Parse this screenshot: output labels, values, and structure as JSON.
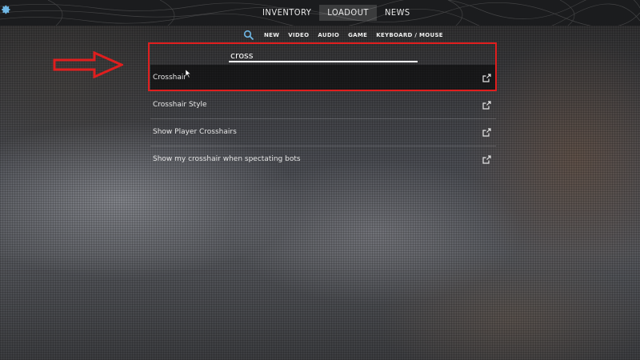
{
  "top_nav": {
    "tabs": [
      {
        "label": "INVENTORY",
        "active": false
      },
      {
        "label": "LOADOUT",
        "active": true
      },
      {
        "label": "NEWS",
        "active": false
      }
    ]
  },
  "settings_icon": "gear-icon",
  "sub_nav": {
    "search_icon": "search-icon",
    "items": [
      "NEW",
      "VIDEO",
      "AUDIO",
      "GAME",
      "KEYBOARD / MOUSE"
    ]
  },
  "search": {
    "value": "cross",
    "placeholder": ""
  },
  "results": [
    {
      "label": "Crosshair",
      "icon": "external-link-icon"
    },
    {
      "label": "Crosshair Style",
      "icon": "external-link-icon"
    },
    {
      "label": "Show Player Crosshairs",
      "icon": "external-link-icon"
    },
    {
      "label": "Show my crosshair when spectating bots",
      "icon": "external-link-icon"
    }
  ],
  "annotation": {
    "color": "#e01e1e",
    "arrow_icon": "right-arrow-icon"
  },
  "colors": {
    "accent": "#6fb8e6",
    "top_bar": "#1b1c1e",
    "text": "#e6e6e6"
  }
}
